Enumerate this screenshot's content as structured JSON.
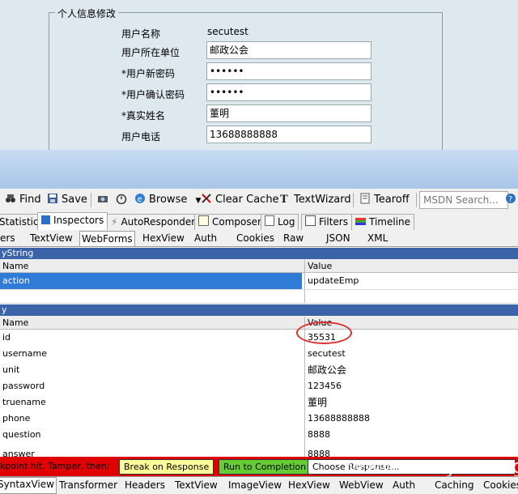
{
  "form": {
    "legend": "个人信息修改",
    "rows": [
      {
        "label": "用户名称",
        "value": ""
      },
      {
        "label": "用户所在单位",
        "value": "邮政公会"
      },
      {
        "label": "*用户新密码",
        "value": "••••••"
      },
      {
        "label": "*用户确认密码",
        "value": "••••••"
      },
      {
        "label": "*真实姓名",
        "value": "董明"
      },
      {
        "label": "用户电话",
        "value": "13688888888"
      }
    ],
    "username_static": "secutest"
  },
  "toolbar": {
    "find": "Find",
    "save": "Save",
    "browse": "Browse",
    "clear_cache": "Clear Cache",
    "textwizard": "TextWizard",
    "tearoff": "Tearoff",
    "msdn_placeholder": "MSDN Search..."
  },
  "tabs1": [
    "Statistics",
    "Inspectors",
    "AutoResponder",
    "Composer",
    "Log",
    "Filters",
    "Timeline"
  ],
  "tabs2": [
    "ers",
    "TextView",
    "WebForms",
    "HexView",
    "Auth",
    "Cookies",
    "Raw",
    "JSON",
    "XML"
  ],
  "querystring": {
    "title": "yString",
    "col_name": "Name",
    "col_value": "Value",
    "rows": [
      {
        "name": "action",
        "value": "updateEmp"
      }
    ]
  },
  "body": {
    "title": "y",
    "col_name": "Name",
    "col_value": "Value",
    "rows": [
      {
        "name": "id",
        "value": "35531"
      },
      {
        "name": "username",
        "value": "secutest"
      },
      {
        "name": "unit",
        "value": "邮政公会"
      },
      {
        "name": "password",
        "value": "123456"
      },
      {
        "name": "truename",
        "value": "董明"
      },
      {
        "name": "phone",
        "value": "13688888888"
      },
      {
        "name": "question",
        "value": "8888"
      },
      {
        "name": "answer",
        "value": "8888"
      }
    ]
  },
  "breakpoint": {
    "text": "kpoint hit. Tamper, then:",
    "break_on_response": "Break on Response",
    "run_to_completion": "Run to Completion",
    "choose_response": "Choose Response..."
  },
  "watermark": "www.wooyun.org",
  "tabs3": [
    "SyntaxView",
    "Transformer",
    "Headers",
    "TextView",
    "ImageView",
    "HexView",
    "WebView",
    "Auth",
    "Caching",
    "Cookies"
  ]
}
